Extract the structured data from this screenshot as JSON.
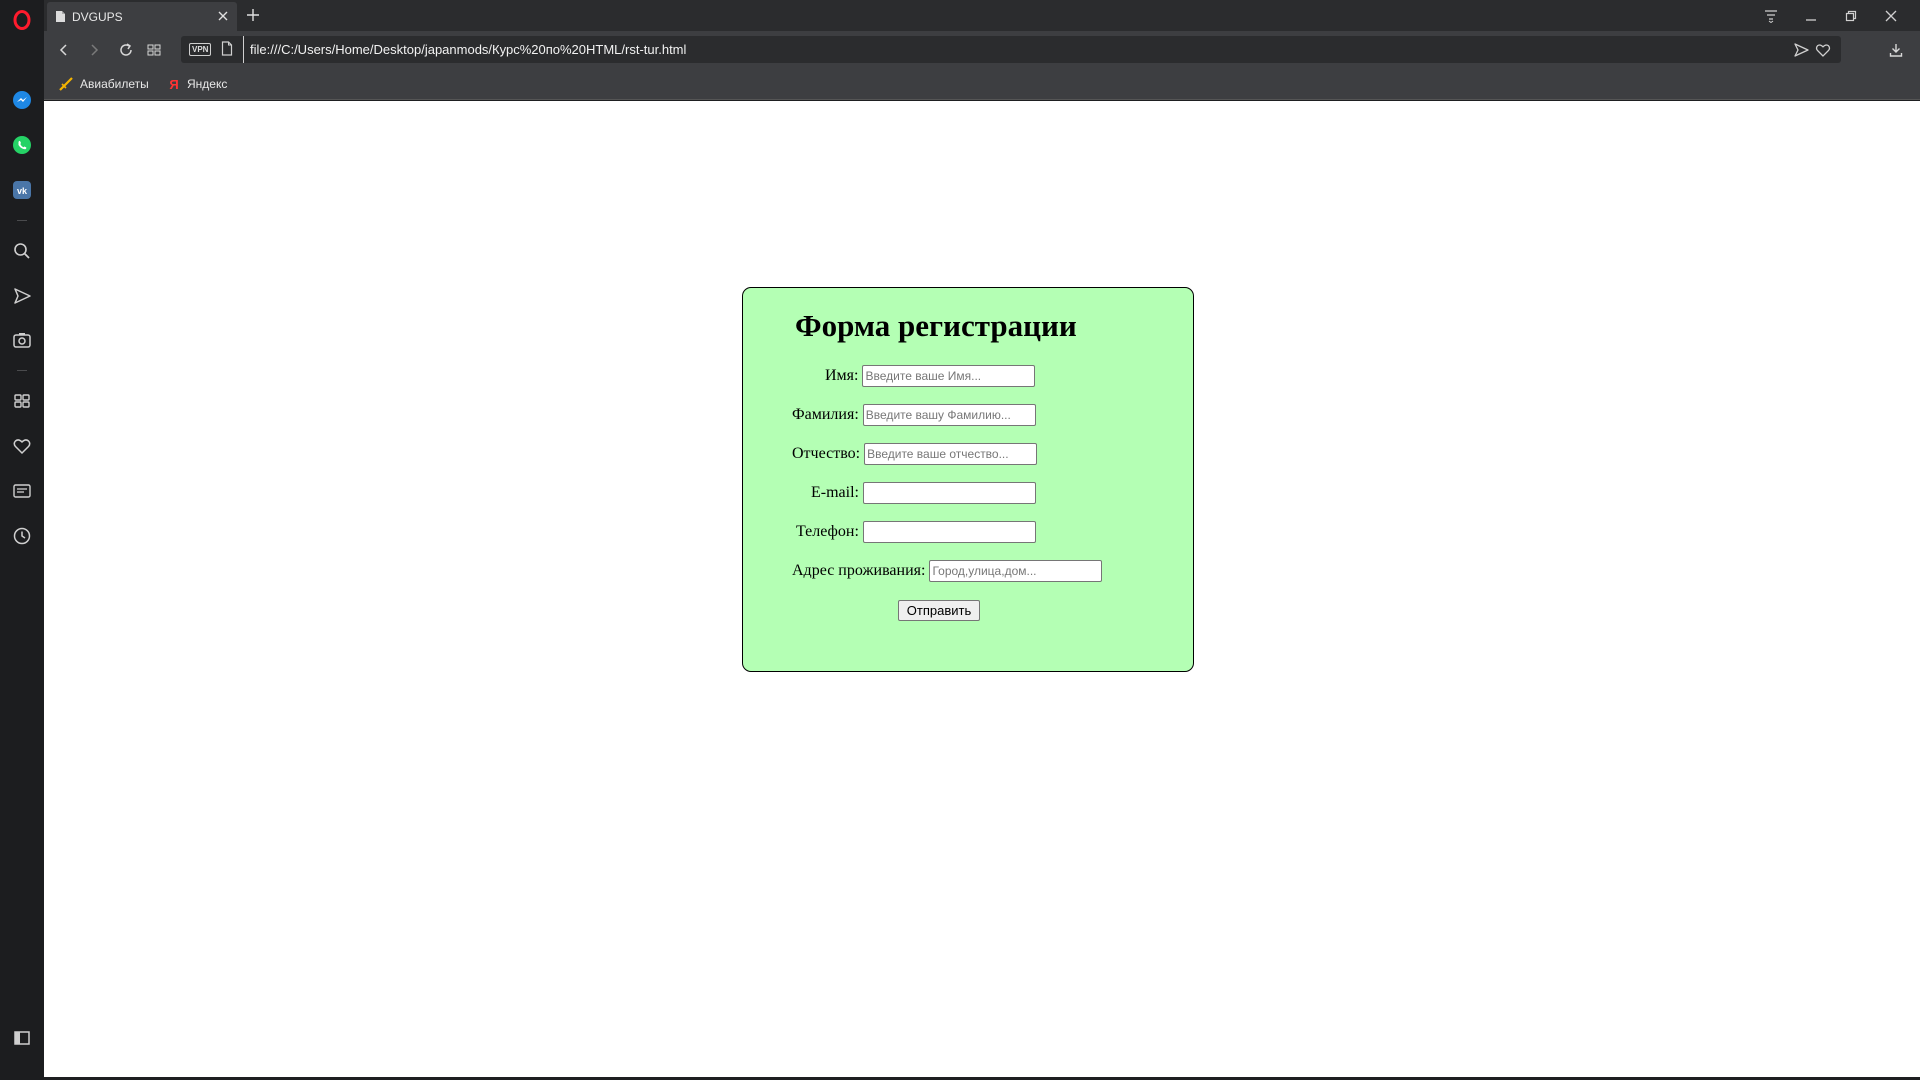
{
  "browser": {
    "tab": {
      "title": "DVGUPS"
    },
    "address": {
      "vpn_label": "VPN",
      "url": "file:///C:/Users/Home/Desktop/japanmods/Курс%20по%20HTML/rst-tur.html"
    },
    "bookmarks": [
      {
        "label": "Авиабилеты",
        "icon": "plane-icon"
      },
      {
        "label": "Яндекс",
        "icon": "yandex-icon"
      }
    ],
    "sidebar_icons": [
      "opera-logo-icon",
      "messenger-icon",
      "whatsapp-icon",
      "vk-icon",
      "search-icon",
      "send-icon",
      "camera-icon",
      "speed-dial-icon",
      "heart-icon",
      "news-icon",
      "history-icon",
      "sidebar-toggle-icon"
    ]
  },
  "form": {
    "title": "Форма регистрации",
    "fields": [
      {
        "label": "Имя:",
        "placeholder": "Введите ваше Имя..."
      },
      {
        "label": "Фамилия:",
        "placeholder": "Введите вашу Фамилию..."
      },
      {
        "label": "Отчество:",
        "placeholder": "Введите ваше отчество..."
      },
      {
        "label": "E-mail:",
        "placeholder": ""
      },
      {
        "label": "Телефон:",
        "placeholder": ""
      },
      {
        "label": "Адрес проживания:",
        "placeholder": "Город,улица,дом..."
      }
    ],
    "submit_label": "Отправить",
    "background_color": "#b4ffb4"
  }
}
